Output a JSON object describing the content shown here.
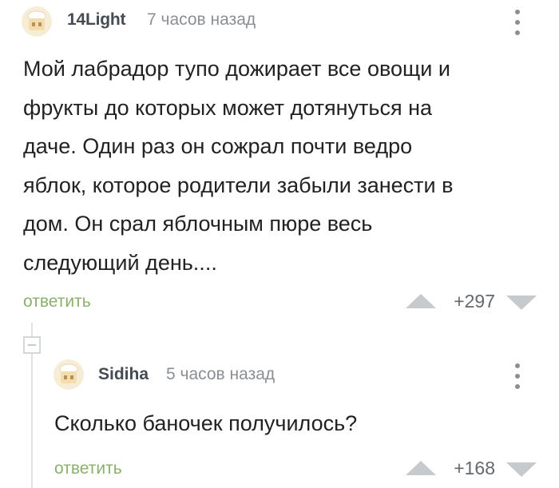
{
  "comment": {
    "author": "14Light",
    "time": "7 часов назад",
    "lines": [
      "Мой лабрадор тупо дожирает все овощи и",
      "фрукты до которых может дотянуться на",
      "даче. Один раз он сожрал почти ведро",
      "яблок, которое родители забыли занести в",
      "дом. Он срал яблочным пюре весь",
      "следующий день...."
    ],
    "reply_label": "ответить",
    "score": "+297"
  },
  "reply": {
    "author": "Sidiha",
    "time": "5 часов назад",
    "text": "Сколько баночек получилось?",
    "reply_label": "ответить",
    "score": "+168"
  },
  "colors": {
    "accent_green": "#8ab16c",
    "avatar_fill": "#f3dcae",
    "vote_arrow": "#c6cacd"
  },
  "icons": [
    "avatar-icon",
    "more-vertical-icon",
    "upvote-icon",
    "downvote-icon",
    "collapse-icon"
  ]
}
